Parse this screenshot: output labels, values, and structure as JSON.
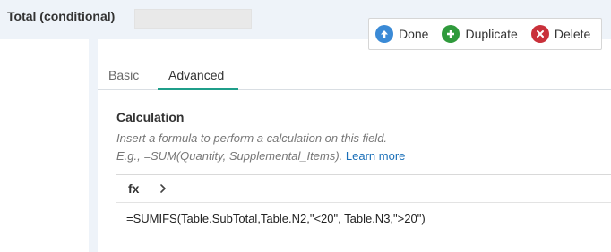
{
  "field": {
    "title": "Total (conditional)"
  },
  "toolbar": {
    "done_label": "Done",
    "duplicate_label": "Duplicate",
    "delete_label": "Delete",
    "icons": {
      "done": "arrow-up-circle-icon",
      "duplicate": "plus-circle-icon",
      "delete": "x-circle-icon"
    },
    "colors": {
      "done": "#3a8ad6",
      "duplicate": "#2f9a3c",
      "delete": "#c9303a"
    }
  },
  "tabs": [
    {
      "label": "Basic",
      "active": false
    },
    {
      "label": "Advanced",
      "active": true
    }
  ],
  "calculation": {
    "title": "Calculation",
    "hint_line1": "Insert a formula to perform a calculation on this field.",
    "hint_line2": "E.g., =SUM(Quantity, Supplemental_Items).",
    "learn_more": "Learn more"
  },
  "editor": {
    "fx_label": "fx",
    "expand_icon": "chevron-right-icon",
    "formula": "=SUMIFS(Table.SubTotal,Table.N2,\"<20\", Table.N3,\">20\")"
  },
  "theme": {
    "accent": "#1f9e8a",
    "background": "#eef3f9"
  }
}
